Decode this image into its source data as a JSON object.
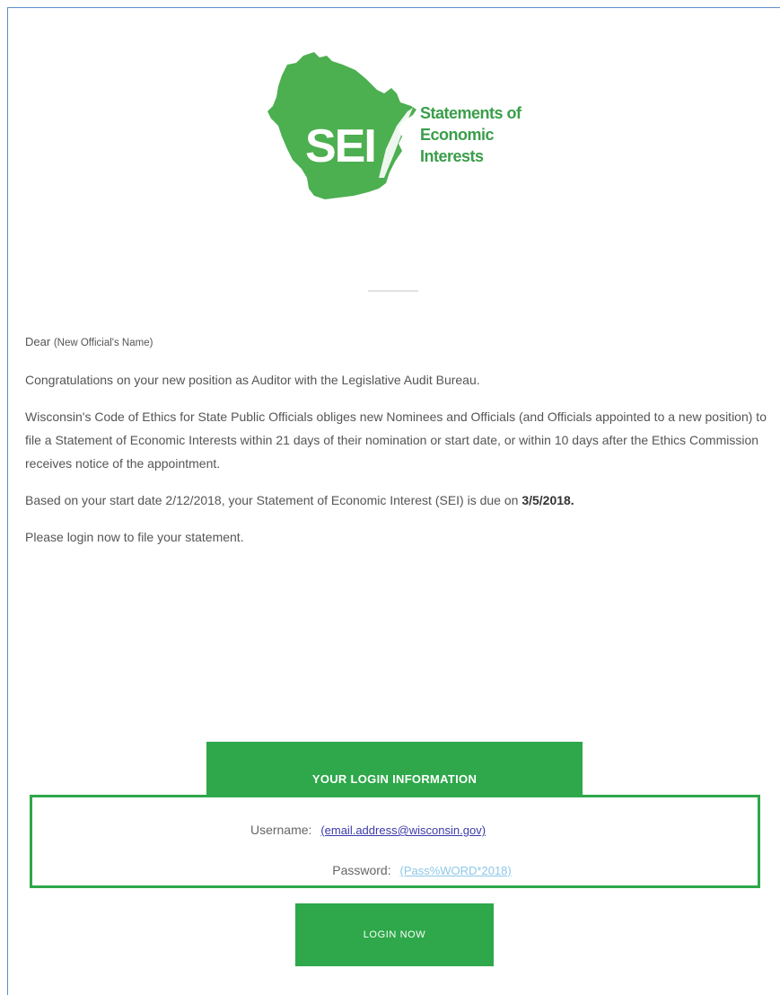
{
  "logo": {
    "mark_text": "SEI",
    "tagline": [
      "Statements of",
      "Economic",
      "Interests"
    ],
    "color": "#4caf50"
  },
  "email": {
    "greeting": "Dear",
    "recipient": "(New Official's Name)",
    "paragraph_1": "Congratulations on your new position as Auditor with the Legislative Audit Bureau.",
    "paragraph_2": "Wisconsin's Code of Ethics for State Public Officials obliges new Nominees and Officials (and Officials appointed to a new position) to file a Statement of Economic Interests within 21 days of their nomination or start date, or within 10 days after the Ethics Commission receives notice of the appointment.",
    "paragraph_3_prefix": "Based on your start date 2/12/2018, your Statement of Economic Interest (SEI) is due on",
    "due_date": "3/5/2018.",
    "paragraph_4": "Please login now to file your statement."
  },
  "login": {
    "header": "YOUR LOGIN INFORMATION",
    "username_label": "Username:",
    "username_value": "(email.address@wisconsin.gov)",
    "password_label": "Password:",
    "password_value": "(Pass%WORD*2018)",
    "button_label": "LOGIN NOW"
  },
  "colors": {
    "accent_green": "#2ea84a",
    "frame_blue": "#5b8fc8",
    "link_blue": "#3a3aaa",
    "link_light_blue": "#8cc8e8"
  }
}
